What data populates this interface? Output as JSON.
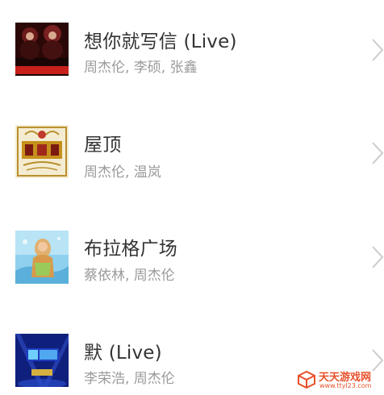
{
  "songs": [
    {
      "title": "想你就写信 (Live)",
      "artists": "周杰伦, 李硕, 张鑫",
      "cover_icon": "sing-china-album-cover",
      "cover_text": "SING! CHINA"
    },
    {
      "title": "屋顶",
      "artists": "周杰伦, 温岚",
      "cover_icon": "gold-ornament-album-cover"
    },
    {
      "title": "布拉格广场",
      "artists": "蔡依林, 周杰伦",
      "cover_icon": "portrait-album-cover"
    },
    {
      "title": "默 (Live)",
      "artists": "李荣浩, 周杰伦",
      "cover_icon": "stage-album-cover"
    }
  ],
  "row_action_icon": "chevron-right-icon",
  "watermark": {
    "name": "天天游戏网",
    "url": "www.ttyl23.com",
    "icon": "cube-logo-icon",
    "color": "#e8502a"
  },
  "colors": {
    "title": "#333333",
    "artist": "#9a9a9a",
    "chevron": "#cccccc",
    "background": "#ffffff"
  }
}
